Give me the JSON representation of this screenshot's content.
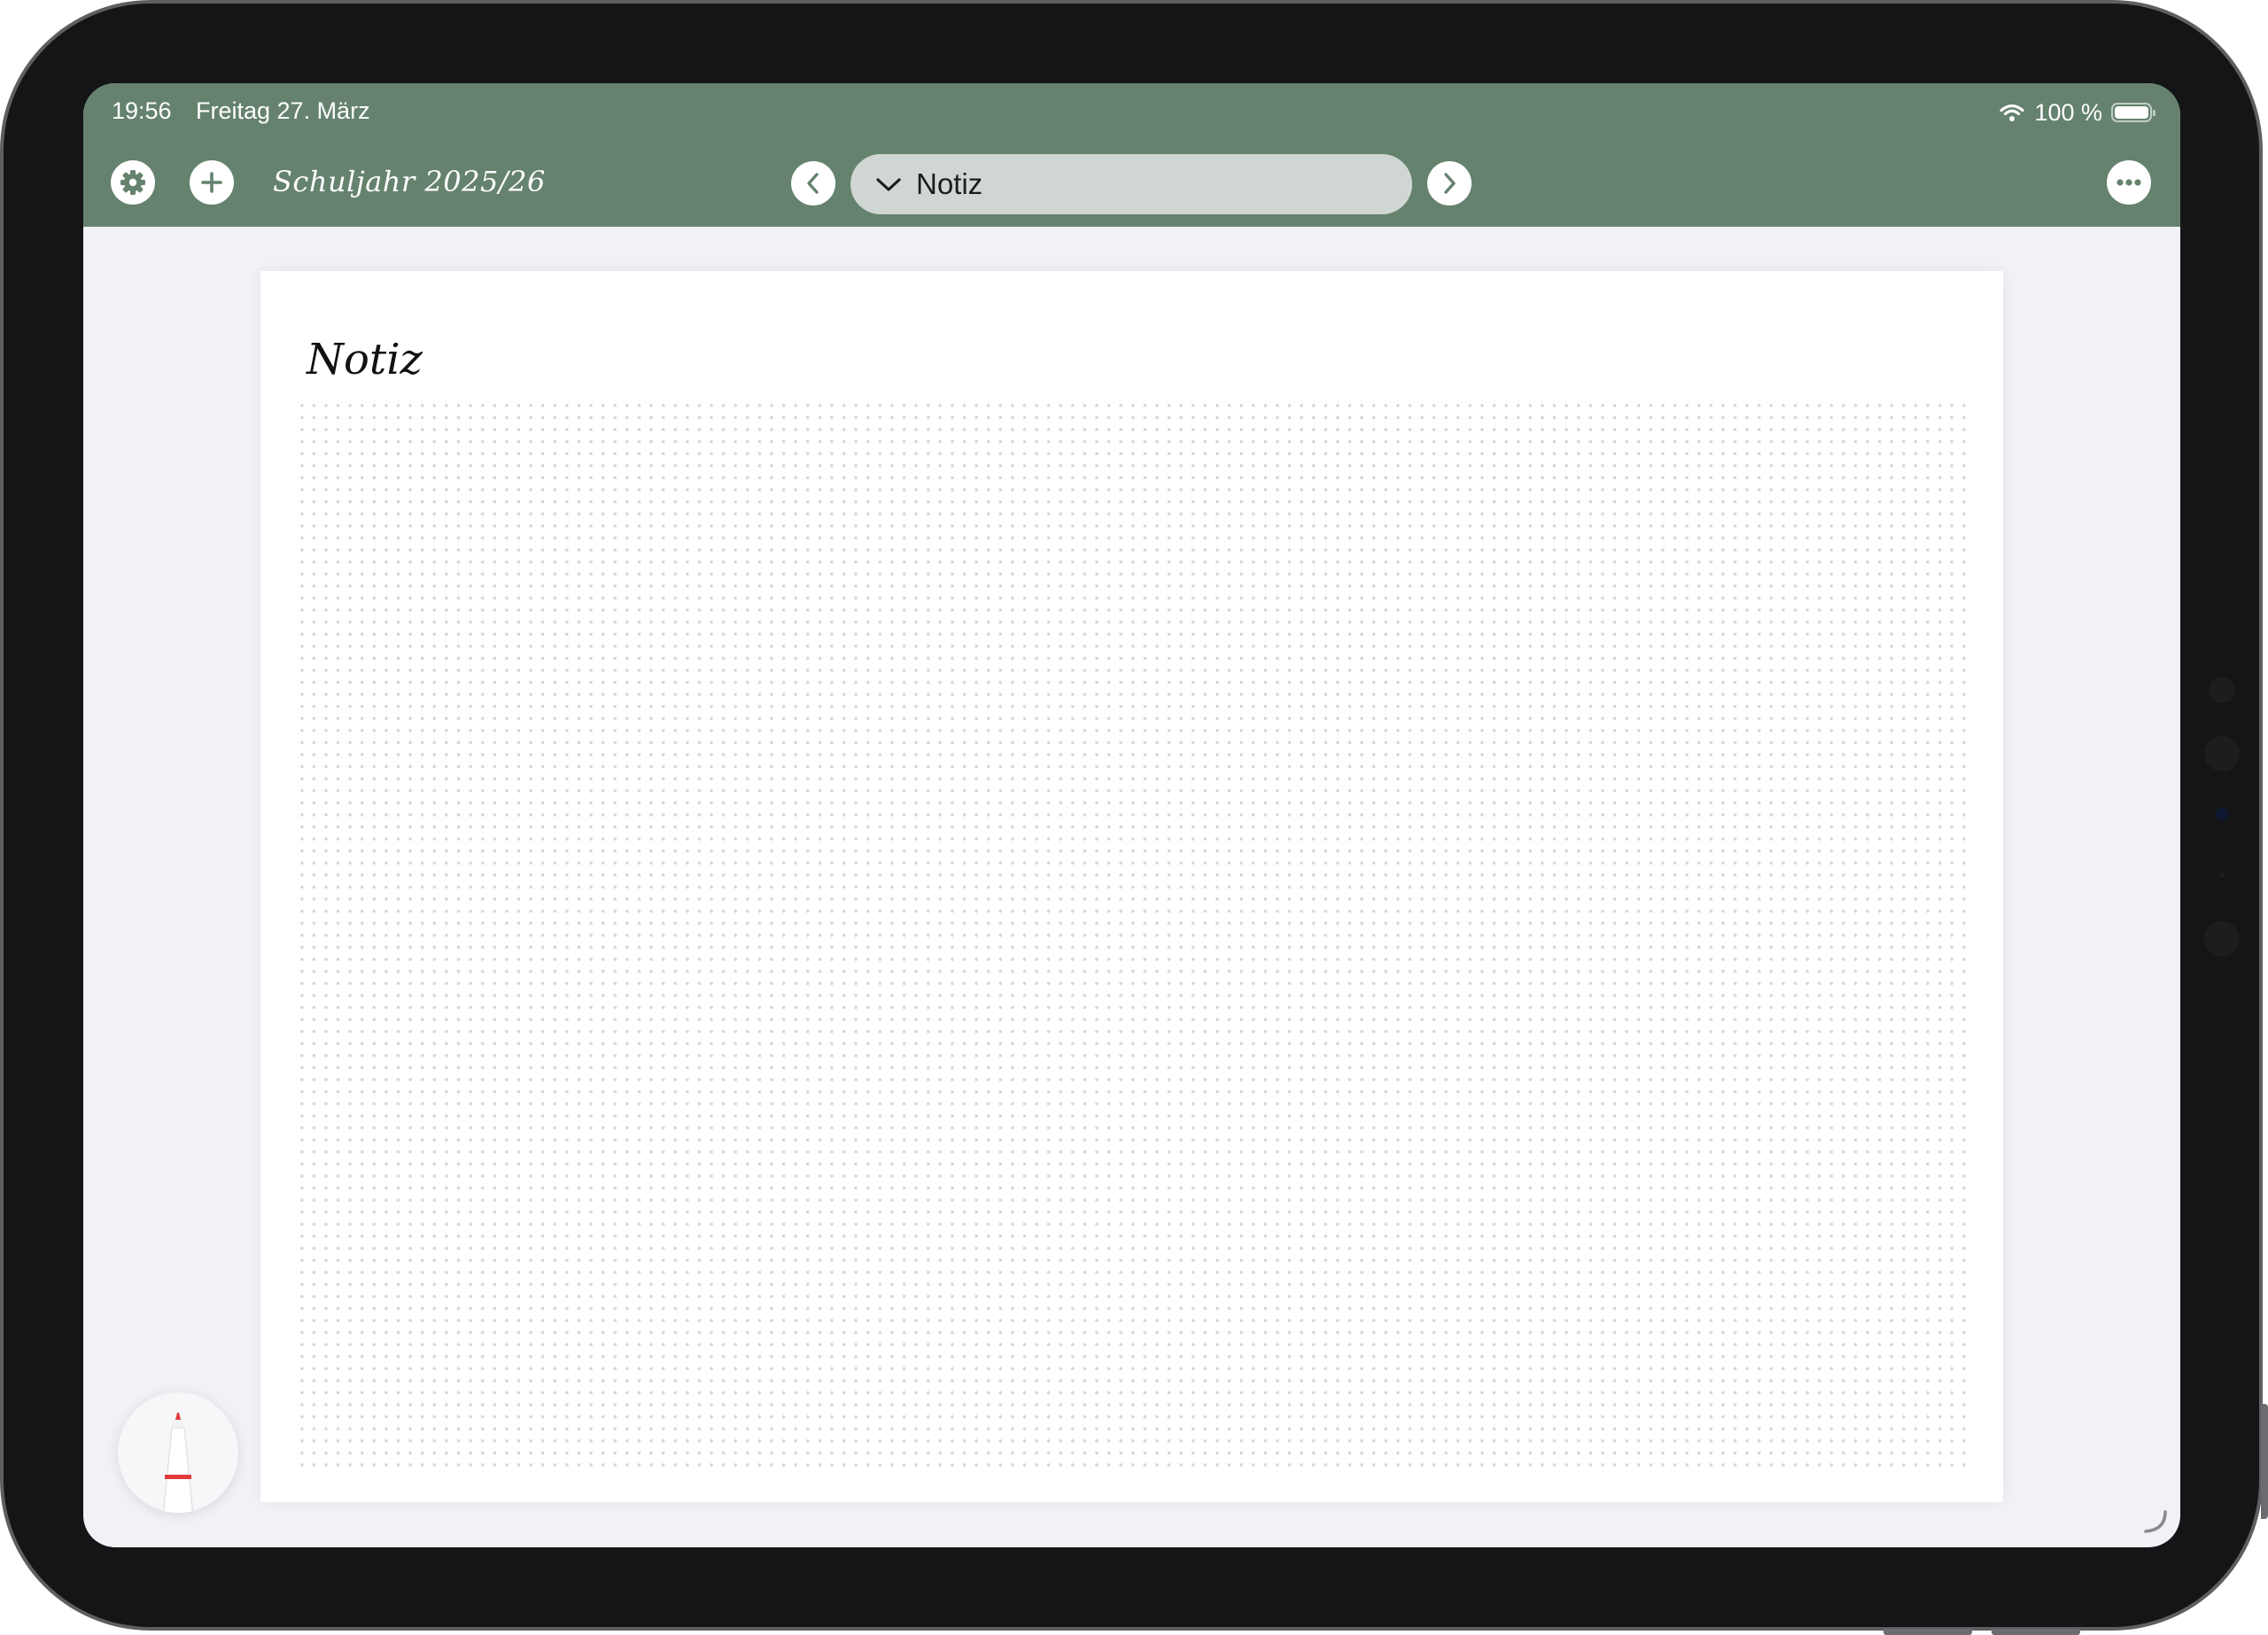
{
  "status_bar": {
    "time": "19:56",
    "date": "Freitag 27. März",
    "battery": "100 %"
  },
  "toolbar": {
    "title": "Schuljahr 2025/26",
    "current_page": "Notiz",
    "accent_color": "#65826e"
  },
  "page": {
    "title": "Notiz",
    "paper_style": "dot-grid"
  }
}
